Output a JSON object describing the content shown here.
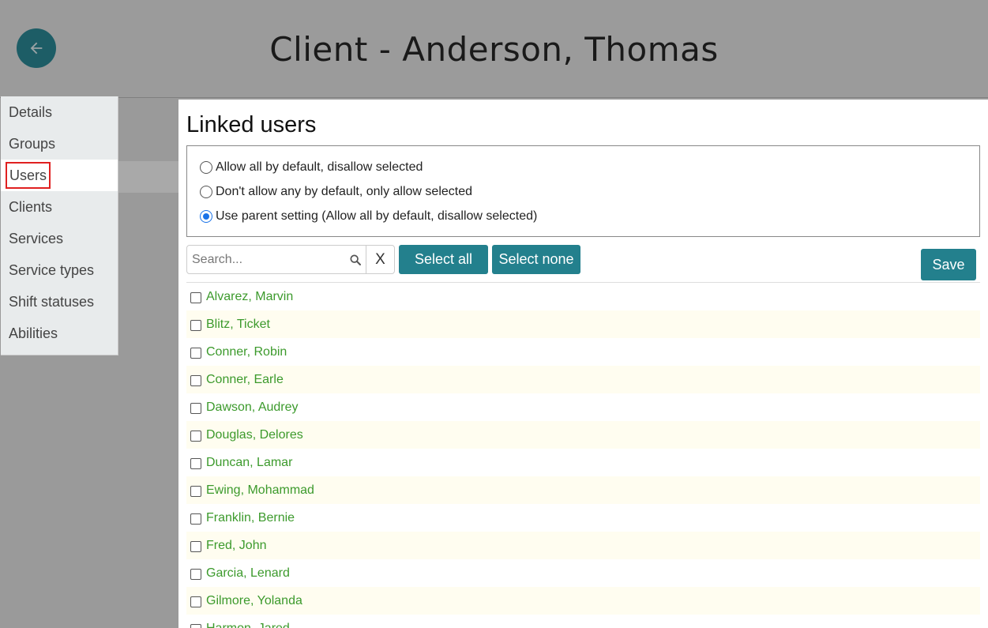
{
  "header": {
    "title": "Client - Anderson, Thomas"
  },
  "sidebar": {
    "items": [
      {
        "label": "Details"
      },
      {
        "label": "Groups"
      },
      {
        "label": "Users"
      },
      {
        "label": "Clients"
      },
      {
        "label": "Services"
      },
      {
        "label": "Service types"
      },
      {
        "label": "Shift statuses"
      },
      {
        "label": "Abilities"
      }
    ],
    "active_item": "Users"
  },
  "main": {
    "title": "Linked users",
    "radio_options": [
      {
        "label": "Allow all by default, disallow selected",
        "checked": false
      },
      {
        "label": "Don't allow any by default, only allow selected",
        "checked": false
      },
      {
        "label": "Use parent setting (Allow all by default, disallow selected)",
        "checked": true
      }
    ],
    "search": {
      "placeholder": "Search...",
      "value": "",
      "clear_label": "X"
    },
    "buttons": {
      "select_all": "Select all",
      "select_none": "Select none",
      "save": "Save"
    },
    "users": [
      "Alvarez, Marvin",
      "Blitz, Ticket",
      "Conner, Robin",
      "Conner, Earle",
      "Dawson, Audrey",
      "Douglas, Delores",
      "Duncan, Lamar",
      "Ewing, Mohammad",
      "Franklin, Bernie",
      "Fred, John",
      "Garcia, Lenard",
      "Gilmore, Yolanda",
      "Harmon, Jared"
    ]
  },
  "colors": {
    "accent": "#23808d",
    "back_button": "#1d5d66",
    "user_name": "#3c9a2c",
    "active_highlight": "#e02020"
  }
}
